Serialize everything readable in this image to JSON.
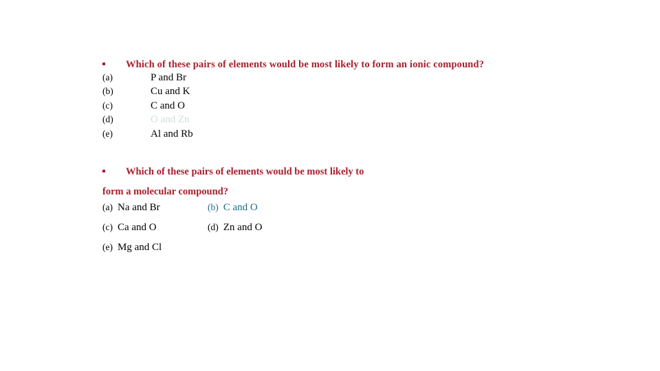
{
  "slide": {
    "background_color": "#ffffff",
    "heading_color": "#a81f2e",
    "body_color": "#000000",
    "highlight_pale_color": "#cfe0d9",
    "highlight_teal_color": "#1a6b8a"
  },
  "question1": {
    "bullet": "•",
    "heading": "Which of these pairs of elements would be most likely to form an ionic compound?",
    "options": [
      {
        "label": "(a)",
        "text": "P and Br",
        "style": "normal"
      },
      {
        "label": "(b)",
        "text": "Cu and K",
        "style": "normal"
      },
      {
        "label": "(c)",
        "text": "C and O",
        "style": "normal"
      },
      {
        "label": "(d)",
        "text": "O and Zn",
        "style": "pale"
      },
      {
        "label": "(e)",
        "text": "Al and Rb",
        "style": "normal"
      }
    ]
  },
  "question2": {
    "bullet": "•",
    "heading_line1": "Which of these pairs of elements would be most likely to",
    "heading_line2": "form a molecular compound?",
    "rows": [
      {
        "left": {
          "label": "(a)",
          "text": "Na and Br",
          "style": "normal"
        },
        "right": {
          "label": "(b)",
          "text": "C and O",
          "style": "teal"
        }
      },
      {
        "left": {
          "label": "(c)",
          "text": "Ca and O",
          "style": "normal"
        },
        "right": {
          "label": "(d)",
          "text": "Zn and O",
          "style": "normal"
        }
      },
      {
        "left": {
          "label": "(e)",
          "text": "Mg and Cl",
          "style": "normal"
        },
        "right": {
          "label": "",
          "text": "",
          "style": "normal"
        }
      }
    ]
  }
}
